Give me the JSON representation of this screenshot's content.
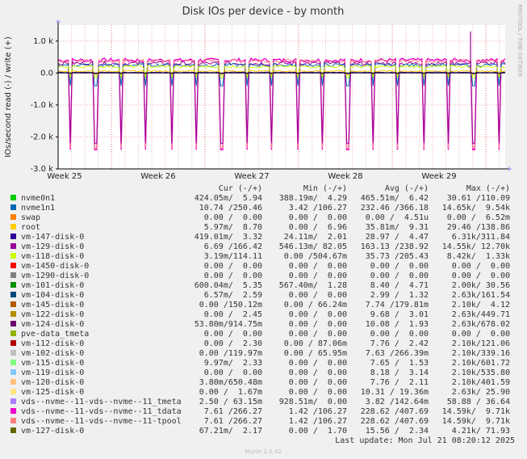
{
  "chart_data": {
    "type": "line",
    "title": "Disk IOs per device - by month",
    "ylabel": "IOs/second read (-) / write (+)",
    "y_ticks": [
      "1.0 k",
      "0.0",
      "-1.0 k",
      "-2.0 k",
      "-3.0 k"
    ],
    "y_tick_values": [
      1000,
      0,
      -1000,
      -2000,
      -3000
    ],
    "ylim": [
      -3000,
      1500
    ],
    "x_ticks": [
      "Week 25",
      "Week 26",
      "Week 27",
      "Week 28",
      "Week 29"
    ],
    "grid": true,
    "side_label": "RRDTOOL / TOBI OETIKER",
    "columns": [
      "Cur (-/+)",
      "Min (-/+)",
      "Avg (-/+)",
      "Max (-/+)"
    ],
    "series": [
      {
        "name": "nvme0n1",
        "color": "#00cc00",
        "cur": "424.05m/  5.94",
        "min": "388.19m/  4.29",
        "avg": "465.51m/  6.42",
        "max": "30.61 /110.09"
      },
      {
        "name": "nvme1n1",
        "color": "#0066b3",
        "cur": "10.74 /250.46",
        "min": "3.42 /106.27",
        "avg": "232.46 /366.18",
        "max": "14.65k/  9.54k"
      },
      {
        "name": "swap",
        "color": "#ff8000",
        "cur": "0.00 /  0.00",
        "min": "0.00 /  0.00",
        "avg": "0.00 /  4.51u",
        "max": "0.00 /  6.52m"
      },
      {
        "name": "root",
        "color": "#ffcc00",
        "cur": "5.97m/  8.70",
        "min": "0.00 /  6.96",
        "avg": "35.81m/  9.31",
        "max": "29.46 /138.86"
      },
      {
        "name": "vm-147-disk-0",
        "color": "#330099",
        "cur": "419.01m/  3.32",
        "min": "24.11m/  2.01",
        "avg": "28.97 /  4.47",
        "max": "6.31k/311.84"
      },
      {
        "name": "vm-129-disk-0",
        "color": "#990099",
        "cur": "6.69 /166.42",
        "min": "546.13m/ 82.05",
        "avg": "163.13 /238.92",
        "max": "14.55k/ 12.70k"
      },
      {
        "name": "vm-118-disk-0",
        "color": "#ccff00",
        "cur": "3.19m/114.11",
        "min": "0.00 /504.67m",
        "avg": "35.73 /205.43",
        "max": "8.42k/  1.33k"
      },
      {
        "name": "vm-1450-disk-0",
        "color": "#ff0000",
        "cur": "0.00 /  0.00",
        "min": "0.00 /  0.00",
        "avg": "0.00 /  0.00",
        "max": "0.00 /  0.00"
      },
      {
        "name": "vm-1290-disk-0",
        "color": "#808080",
        "cur": "0.00 /  0.00",
        "min": "0.00 /  0.00",
        "avg": "0.00 /  0.00",
        "max": "0.00 /  0.00"
      },
      {
        "name": "vm-101-disk-0",
        "color": "#008f00",
        "cur": "600.04m/  5.35",
        "min": "567.40m/  1.28",
        "avg": "8.40 /  4.71",
        "max": "2.00k/ 30.56"
      },
      {
        "name": "vm-104-disk-0",
        "color": "#00487d",
        "cur": "6.57m/  2.59",
        "min": "0.00 /  0.00",
        "avg": "2.99 /  1.32",
        "max": "2.63k/161.54"
      },
      {
        "name": "vm-145-disk-0",
        "color": "#b35a00",
        "cur": "0.00 /150.12m",
        "min": "0.00 / 66.24m",
        "avg": "7.74 /179.81m",
        "max": "2.10k/  4.12"
      },
      {
        "name": "vm-122-disk-0",
        "color": "#b38f00",
        "cur": "0.00 /  2.45",
        "min": "0.00 /  0.00",
        "avg": "9.68 /  3.01",
        "max": "2.63k/449.71"
      },
      {
        "name": "vm-124-disk-0",
        "color": "#6b006b",
        "cur": "53.80m/914.75m",
        "min": "0.00 /  0.00",
        "avg": "10.08 /  1.93",
        "max": "2.63k/678.02"
      },
      {
        "name": "pve-data_tmeta",
        "color": "#8fb300",
        "cur": "0.00 /  0.00",
        "min": "0.00 /  0.00",
        "avg": "0.00 /  0.00",
        "max": "0.00 /  0.00"
      },
      {
        "name": "vm-112-disk-0",
        "color": "#b30000",
        "cur": "0.00 /  2.30",
        "min": "0.00 / 87.06m",
        "avg": "7.76 /  2.42",
        "max": "2.10k/121.06"
      },
      {
        "name": "vm-102-disk-0",
        "color": "#bebebe",
        "cur": "0.00 /119.97m",
        "min": "0.00 / 65.95m",
        "avg": "7.63 /266.39m",
        "max": "2.10k/339.16"
      },
      {
        "name": "vm-115-disk-0",
        "color": "#80ff80",
        "cur": "9.97m/  2.33",
        "min": "0.00 /  0.00",
        "avg": "7.65 /  1.53",
        "max": "2.10k/601.72"
      },
      {
        "name": "vm-119-disk-0",
        "color": "#80c9ff",
        "cur": "0.00 /  0.00",
        "min": "0.00 /  0.00",
        "avg": "8.18 /  3.14",
        "max": "2.10k/535.80"
      },
      {
        "name": "vm-120-disk-0",
        "color": "#ffc080",
        "cur": "3.80m/650.48m",
        "min": "0.00 /  0.00",
        "avg": "7.76 /  2.11",
        "max": "2.10k/401.59"
      },
      {
        "name": "vm-125-disk-0",
        "color": "#ffe680",
        "cur": "0.00 /  1.67m",
        "min": "0.00 /  0.00",
        "avg": "10.31 / 19.36m",
        "max": "2.63k/ 25.90"
      },
      {
        "name": "vds--nvme--11-vds--nvme--11_tmeta",
        "color": "#aa80ff",
        "cur": "2.50 / 63.15m",
        "min": "928.51m/  0.00",
        "avg": "3.82 /142.64m",
        "max": "58.88 / 36.64"
      },
      {
        "name": "vds--nvme--11-vds--nvme--11_tdata",
        "color": "#ee00cc",
        "cur": "7.61 /266.27",
        "min": "1.42 /106.27",
        "avg": "228.62 /407.69",
        "max": "14.59k/  9.71k"
      },
      {
        "name": "vds--nvme--11-vds--nvme--11-tpool",
        "color": "#ff8080",
        "cur": "7.61 /266.27",
        "min": "1.42 /106.27",
        "avg": "228.62 /407.69",
        "max": "14.59k/  9.71k"
      },
      {
        "name": "vm-127-disk-0",
        "color": "#666600",
        "cur": "67.21m/  2.17",
        "min": "0.00 /  1.70",
        "avg": "15.56 /  2.34",
        "max": "4.21k/ 71.93"
      }
    ],
    "last_update": "Last update: Mon Jul 21 08:20:12 2025",
    "footer": "Munin 2.0.42"
  }
}
